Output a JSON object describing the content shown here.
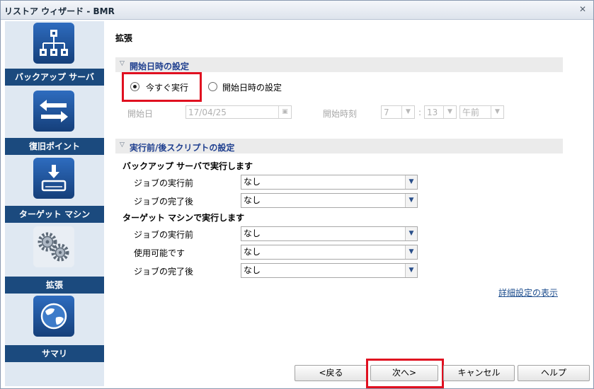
{
  "window": {
    "title": "リストア ウィザード - BMR",
    "close_glyph": "✕"
  },
  "sidebar": {
    "items": [
      {
        "label": "バックアップ サーバ",
        "icon": "backup-server-icon"
      },
      {
        "label": "復旧ポイント",
        "icon": "recovery-point-icon"
      },
      {
        "label": "ターゲット マシン",
        "icon": "target-machine-icon"
      },
      {
        "label": "拡張",
        "icon": "gears-icon",
        "active": true
      },
      {
        "label": "サマリ",
        "icon": "globe-icon"
      }
    ]
  },
  "main": {
    "title": "拡張",
    "start_section": {
      "header": "開始日時の設定",
      "radio_now": "今すぐ実行",
      "radio_scheduled": "開始日時の設定",
      "selected": "今すぐ実行",
      "date_label": "開始日",
      "date_value": "17/04/25",
      "time_label": "開始時刻",
      "hour": "7",
      "minute": "13",
      "ampm": "午前",
      "time_sep": ":"
    },
    "script_section": {
      "header": "実行前/後スクリプトの設定",
      "backup_server_heading": "バックアップ サーバで実行します",
      "backup_server_rows": [
        {
          "label": "ジョブの実行前",
          "value": "なし"
        },
        {
          "label": "ジョブの完了後",
          "value": "なし"
        }
      ],
      "target_machine_heading": "ターゲット マシンで実行します",
      "target_machine_rows": [
        {
          "label": "ジョブの実行前",
          "value": "なし"
        },
        {
          "label": "使用可能です",
          "value": "なし"
        },
        {
          "label": "ジョブの完了後",
          "value": "なし"
        }
      ]
    },
    "advanced_link": "詳細設定の表示"
  },
  "footer": {
    "back": "<戻る",
    "next": "次へ>",
    "cancel": "キャンセル",
    "help": "ヘルプ"
  },
  "colors": {
    "sidebar_label": "#1b4a7e",
    "highlight": "#e01020",
    "section_header_text": "#1f3f8f"
  }
}
